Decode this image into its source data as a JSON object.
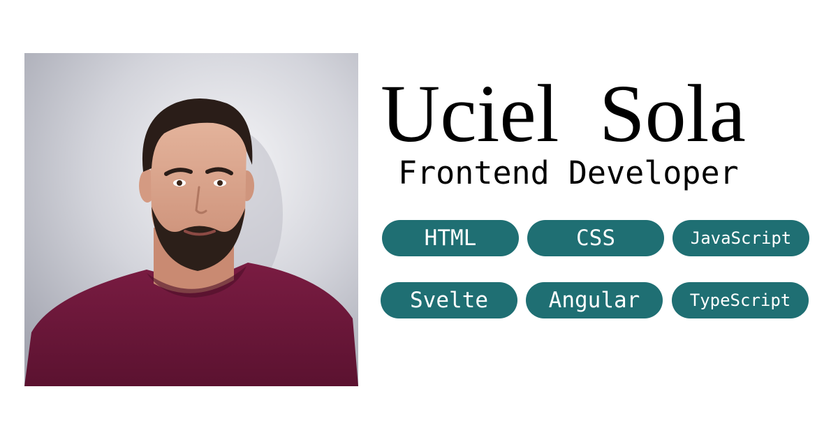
{
  "profile": {
    "name": "Uciel Sola",
    "role": "Frontend Developer"
  },
  "skills": [
    {
      "label": "HTML"
    },
    {
      "label": "CSS"
    },
    {
      "label": "JavaScript"
    },
    {
      "label": "Svelte"
    },
    {
      "label": "Angular"
    },
    {
      "label": "TypeScript"
    }
  ],
  "colors": {
    "pill_background": "#1f6f73",
    "pill_text": "#ffffff",
    "text": "#000000",
    "page_background": "#ffffff",
    "shirt": "#6e1a3b"
  }
}
